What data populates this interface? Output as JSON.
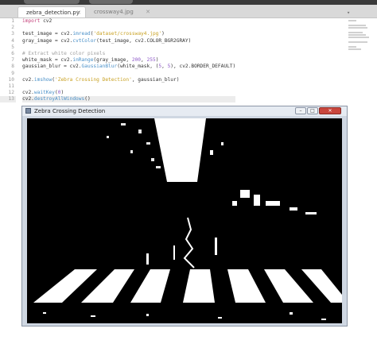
{
  "tabs": [
    {
      "label": "zebra_detection.py",
      "active": true
    },
    {
      "label": "crossway4.jpg",
      "active": false
    }
  ],
  "editor": {
    "lines": [
      {
        "n": "1",
        "code": [
          {
            "t": "import",
            "c": "kw"
          },
          {
            "t": " cv2",
            "c": ""
          }
        ]
      },
      {
        "n": "2",
        "code": []
      },
      {
        "n": "3",
        "code": [
          {
            "t": "test_image = cv2.",
            "c": ""
          },
          {
            "t": "imread",
            "c": "fn"
          },
          {
            "t": "(",
            "c": ""
          },
          {
            "t": "'dataset/crossway4.jpg'",
            "c": "st"
          },
          {
            "t": ")",
            "c": ""
          }
        ]
      },
      {
        "n": "4",
        "code": [
          {
            "t": "gray_image = cv2.",
            "c": ""
          },
          {
            "t": "cvtColor",
            "c": "fn"
          },
          {
            "t": "(test_image, cv2.COLOR_BGR2GRAY)",
            "c": ""
          }
        ]
      },
      {
        "n": "5",
        "code": []
      },
      {
        "n": "6",
        "code": [
          {
            "t": "# Extract white color pixels",
            "c": "cm"
          }
        ]
      },
      {
        "n": "7",
        "code": [
          {
            "t": "white_mask = cv2.",
            "c": ""
          },
          {
            "t": "inRange",
            "c": "fn"
          },
          {
            "t": "(gray_image, ",
            "c": ""
          },
          {
            "t": "200",
            "c": "nu"
          },
          {
            "t": ", ",
            "c": ""
          },
          {
            "t": "255",
            "c": "nu"
          },
          {
            "t": ")",
            "c": ""
          }
        ]
      },
      {
        "n": "8",
        "code": [
          {
            "t": "gaussian_blur = cv2.",
            "c": ""
          },
          {
            "t": "GaussianBlur",
            "c": "fn"
          },
          {
            "t": "(white_mask, (",
            "c": ""
          },
          {
            "t": "5",
            "c": "nu"
          },
          {
            "t": ", ",
            "c": ""
          },
          {
            "t": "5",
            "c": "nu"
          },
          {
            "t": "), cv2.BORDER_DEFAULT)",
            "c": ""
          }
        ]
      },
      {
        "n": "9",
        "code": []
      },
      {
        "n": "10",
        "code": [
          {
            "t": "cv2.",
            "c": ""
          },
          {
            "t": "imshow",
            "c": "fn"
          },
          {
            "t": "(",
            "c": ""
          },
          {
            "t": "'Zebra Crossing Detection'",
            "c": "st"
          },
          {
            "t": ", gaussian_blur)",
            "c": ""
          }
        ]
      },
      {
        "n": "11",
        "code": []
      },
      {
        "n": "12",
        "code": [
          {
            "t": "cv2.",
            "c": ""
          },
          {
            "t": "waitKey",
            "c": "fn"
          },
          {
            "t": "(",
            "c": ""
          },
          {
            "t": "0",
            "c": "nu"
          },
          {
            "t": ")",
            "c": ""
          }
        ]
      },
      {
        "n": "13",
        "code": [
          {
            "t": "cv2.",
            "c": ""
          },
          {
            "t": "destroyAllWindows",
            "c": "fn"
          },
          {
            "t": "()",
            "c": ""
          }
        ],
        "current": true
      }
    ]
  },
  "window": {
    "title": "Zebra Crossing Detection"
  },
  "colors": {
    "keyword": "#c4417a",
    "function": "#4a90c8",
    "string": "#c8a020",
    "number": "#8e5ac8",
    "comment": "#a0a0a0",
    "close_button": "#c9463d"
  }
}
